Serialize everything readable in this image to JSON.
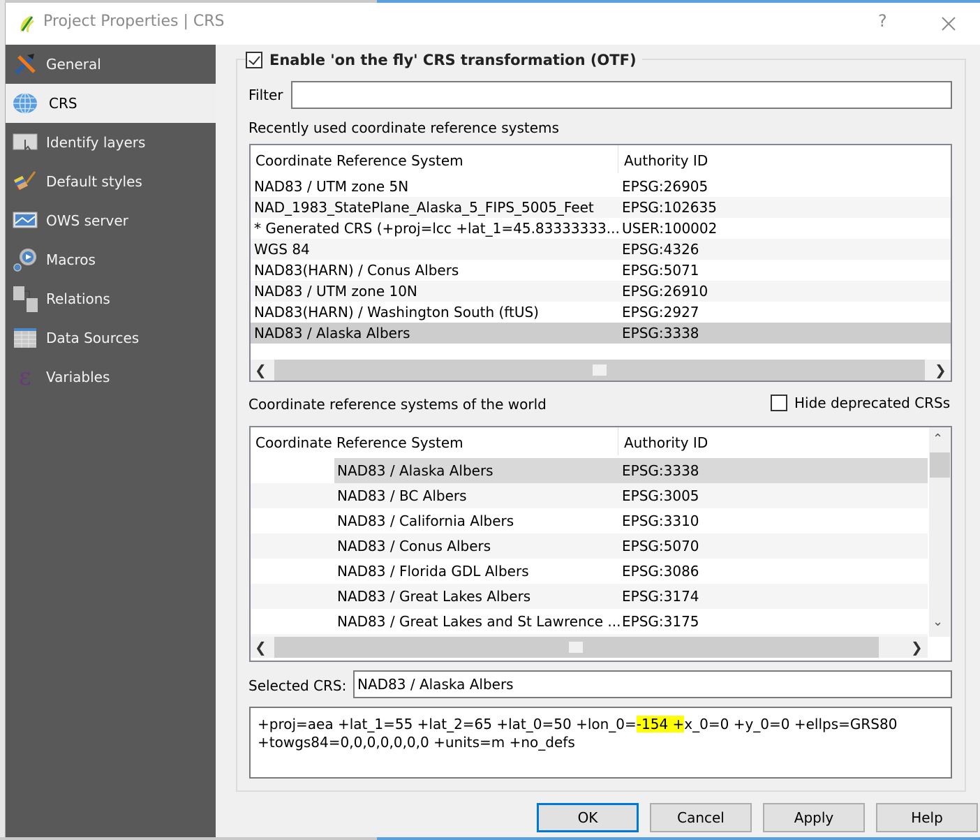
{
  "window": {
    "title": "Project Properties | CRS",
    "help_glyph": "?",
    "close_glyph": "✕"
  },
  "sidebar": {
    "items": [
      {
        "label": "General",
        "icon": "hammer-wrench-icon",
        "active": false
      },
      {
        "label": "CRS",
        "icon": "globe-icon",
        "active": true
      },
      {
        "label": "Identify layers",
        "icon": "identify-icon",
        "active": false
      },
      {
        "label": "Default styles",
        "icon": "paintbrush-icon",
        "active": false
      },
      {
        "label": "OWS server",
        "icon": "ows-server-icon",
        "active": false
      },
      {
        "label": "Macros",
        "icon": "gear-play-icon",
        "active": false
      },
      {
        "label": "Relations",
        "icon": "relations-icon",
        "active": false
      },
      {
        "label": "Data Sources",
        "icon": "table-icon",
        "active": false
      },
      {
        "label": "Variables",
        "icon": "epsilon-icon",
        "active": false
      }
    ]
  },
  "crs": {
    "otf_label": "Enable 'on the fly' CRS transformation (OTF)",
    "otf_checked": true,
    "filter_label": "Filter",
    "filter_value": "",
    "recent_label": "Recently used coordinate reference systems",
    "columns": [
      "Coordinate Reference System",
      "Authority ID"
    ],
    "recent_rows": [
      {
        "name": "NAD83 / UTM zone 5N",
        "id": "EPSG:26905"
      },
      {
        "name": "NAD_1983_StatePlane_Alaska_5_FIPS_5005_Feet",
        "id": "EPSG:102635"
      },
      {
        "name": " * Generated CRS (+proj=lcc +lat_1=45.83333333...",
        "id": "USER:100002"
      },
      {
        "name": "WGS 84",
        "id": "EPSG:4326"
      },
      {
        "name": "NAD83(HARN) / Conus Albers",
        "id": "EPSG:5071"
      },
      {
        "name": "NAD83 / UTM zone 10N",
        "id": "EPSG:26910"
      },
      {
        "name": "NAD83(HARN) / Washington South (ftUS)",
        "id": "EPSG:2927"
      },
      {
        "name": "NAD83 / Alaska Albers",
        "id": "EPSG:3338",
        "selected": true
      }
    ],
    "world_label": "Coordinate reference systems of the world",
    "hide_deprecated_label": "Hide deprecated CRSs",
    "hide_deprecated_checked": false,
    "world_rows": [
      {
        "name": "NAD83 / Alaska Albers",
        "id": "EPSG:3338",
        "selected": true
      },
      {
        "name": "NAD83 / BC Albers",
        "id": "EPSG:3005"
      },
      {
        "name": "NAD83 / California Albers",
        "id": "EPSG:3310"
      },
      {
        "name": "NAD83 / Conus Albers",
        "id": "EPSG:5070"
      },
      {
        "name": "NAD83 / Florida GDL Albers",
        "id": "EPSG:3086"
      },
      {
        "name": "NAD83 / Great Lakes Albers",
        "id": "EPSG:3174"
      },
      {
        "name": "NAD83 / Great Lakes and St Lawrence ...",
        "id": "EPSG:3175"
      }
    ],
    "selected_label": "Selected CRS:",
    "selected_value": "NAD83 / Alaska Albers",
    "proj_line1_pre": "+proj=aea +lat_1=55 +lat_2=65 +lat_0=50 +lon_0=",
    "proj_line1_highlight": "-154 +",
    "proj_line1_post": "x_0=0 +y_0=0 +ellps=GRS80",
    "proj_line2": "+towgs84=0,0,0,0,0,0,0 +units=m +no_defs",
    "highlight_color": "#ffff00"
  },
  "buttons": {
    "ok": "OK",
    "cancel": "Cancel",
    "apply": "Apply",
    "help": "Help"
  },
  "scroll_glyphs": {
    "left": "❮",
    "right": "❯",
    "up": "⌃",
    "down": "⌄"
  }
}
